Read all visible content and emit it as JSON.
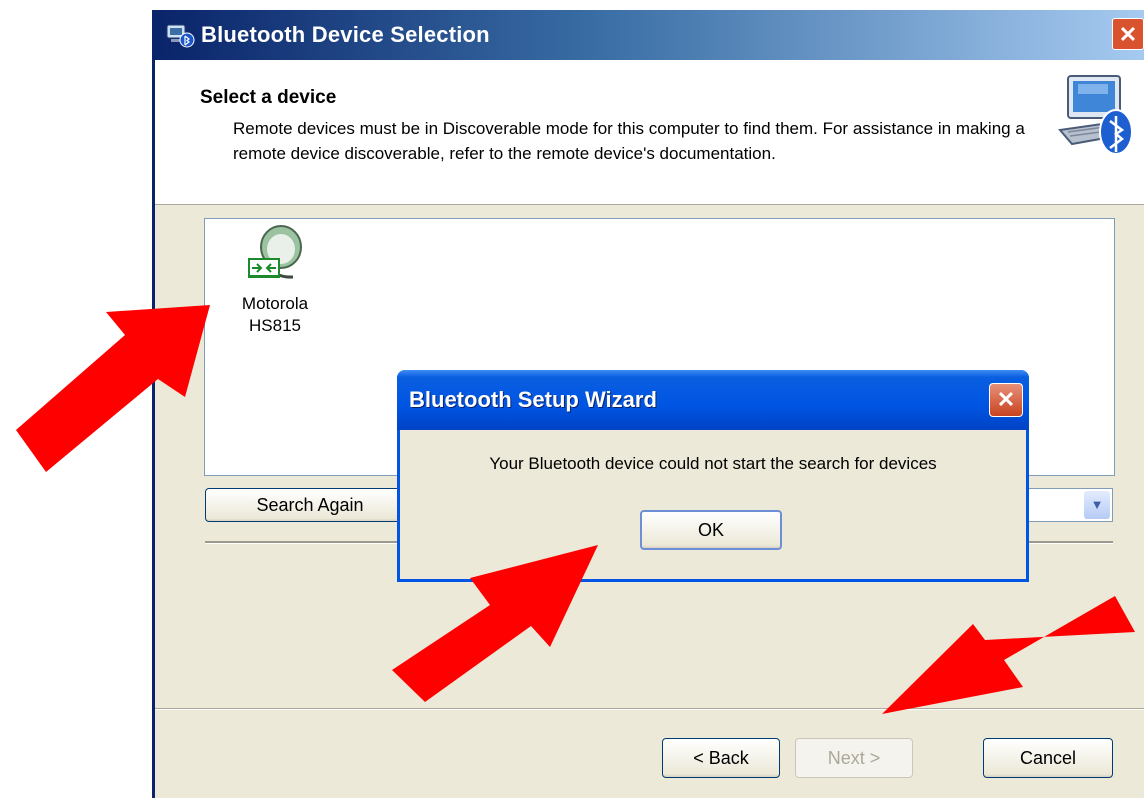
{
  "window": {
    "title": "Bluetooth Device Selection",
    "close_glyph": "✕",
    "icon": "bluetooth-window-icon"
  },
  "header": {
    "title": "Select a device",
    "description": "Remote devices must be in Discoverable mode for this computer to find them. For assistance in making a remote device discoverable, refer to the remote device's documentation.",
    "icon": "computer-bluetooth-icon"
  },
  "device_list": {
    "items": [
      {
        "name_line1": "Motorola",
        "name_line2": "HS815",
        "icon": "headset-icon"
      }
    ]
  },
  "controls": {
    "search_again_label": "Search Again",
    "combo_value": ""
  },
  "footer": {
    "back_label": "< Back",
    "next_label": "Next >",
    "cancel_label": "Cancel"
  },
  "dialog": {
    "title": "Bluetooth Setup Wizard",
    "message": "Your Bluetooth device could not start the search for devices",
    "ok_label": "OK",
    "close_glyph": "✕"
  },
  "annotation": {
    "arrow_color": "#ff0000",
    "arrow_count": 3
  },
  "colors": {
    "titlebar_dark": "#0a246a",
    "dialog_title": "#0054e3",
    "window_bg": "#ece9d8",
    "close_red": "#d9542e"
  }
}
